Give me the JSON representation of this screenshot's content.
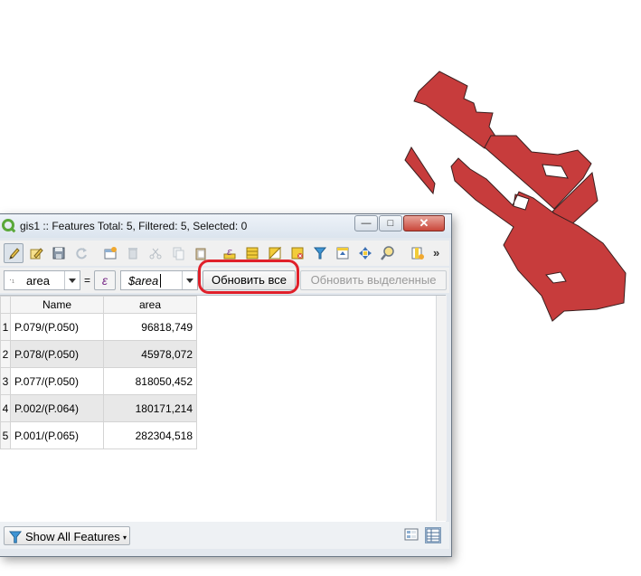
{
  "window": {
    "title": "gis1 :: Features Total: 5, Filtered: 5, Selected: 0",
    "controls": {
      "minimize": "—",
      "maximize": "□",
      "close": "✕"
    }
  },
  "toolbar": {
    "icons": [
      "toggle-editing-icon",
      "multi-edit-icon",
      "save-edits-icon",
      "reload-icon",
      "add-feature-icon",
      "delete-feature-icon",
      "cut-icon",
      "copy-icon",
      "paste-icon",
      "expression-select-icon",
      "select-all-icon",
      "invert-selection-icon",
      "deselect-all-icon",
      "filter-selection-icon",
      "move-selection-to-top-icon",
      "pan-to-selection-icon",
      "zoom-to-selection-icon",
      "new-field-icon"
    ],
    "more": "»"
  },
  "calc": {
    "field": "area",
    "equals": "=",
    "expression_symbol": "ε",
    "expression": "$area",
    "update_all": "Обновить все",
    "update_selected": "Обновить выделенные"
  },
  "table": {
    "columns": [
      "Name",
      "area"
    ],
    "rows": [
      {
        "num": "1",
        "name": "P.079/(P.050)",
        "area": "96818,749"
      },
      {
        "num": "2",
        "name": "P.078/(P.050)",
        "area": "45978,072"
      },
      {
        "num": "3",
        "name": "P.077/(P.050)",
        "area": "818050,452"
      },
      {
        "num": "4",
        "name": "P.002/(P.064)",
        "area": "180171,214"
      },
      {
        "num": "5",
        "name": "P.001/(P.065)",
        "area": "282304,518"
      }
    ]
  },
  "bottom": {
    "show_all": "Show All Features",
    "view_modes": [
      "form-view-icon",
      "table-view-icon"
    ]
  },
  "colors": {
    "polygon_fill": "#c73c3c",
    "polygon_stroke": "#3a1f1f",
    "highlight": "#e0202a"
  }
}
